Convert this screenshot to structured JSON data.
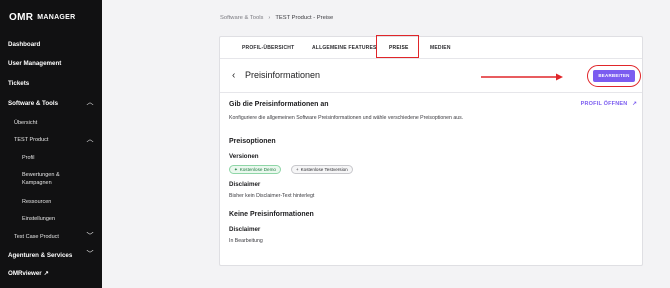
{
  "sidebar": {
    "logo_mark": "OMR",
    "logo_sub": "MANAGER",
    "dashboard": "Dashboard",
    "user_management": "User Management",
    "tickets": "Tickets",
    "software_tools": "Software & Tools",
    "uebersicht": "Übersicht",
    "test_product": "TEST Product",
    "profil": "Profil",
    "bewertungen_line1": "Bewertungen &",
    "bewertungen_line2": "Kampagnen",
    "ressourcen": "Ressourcen",
    "einstellungen": "Einstellungen",
    "test_case_product": "Test Case Product",
    "agenturen": "Agenturen & Services",
    "omrviewer": "OMRviewer"
  },
  "breadcrumb": {
    "parent": "Software & Tools",
    "separator": "›",
    "current": "TEST Product - Preise"
  },
  "tabs": [
    {
      "label": "PROFIL-ÜBERSICHT"
    },
    {
      "label": "ALLGEMEINE FEATURES"
    },
    {
      "label": "PREISE"
    },
    {
      "label": "MEDIEN"
    }
  ],
  "header": {
    "title": "Preisinformationen",
    "edit_label": "BEARBEITEN"
  },
  "section1": {
    "title": "Gib die Preisinformationen an",
    "description": "Konfiguriere die allgemeinen Software Preisinformationen und wähle verschiedene Preisoptionen aus.",
    "profile_link": "PROFIL ÖFFNEN"
  },
  "preisoptionen": {
    "title": "Preisoptionen",
    "versionen_label": "Versionen",
    "chips": [
      {
        "label": "Kostenlose Demo"
      },
      {
        "label": "Kostenlose Testversion"
      }
    ],
    "disclaimer_label": "Disclaimer",
    "disclaimer_text": "Bisher kein Disclaimer-Text hinterlegt"
  },
  "keine": {
    "title": "Keine Preisinformationen",
    "disclaimer_label": "Disclaimer",
    "disclaimer_text": "In Bearbeitung"
  },
  "colors": {
    "accent": "#7b5cf0",
    "annotation_red": "#e0262a",
    "sidebar_bg": "#111112"
  }
}
